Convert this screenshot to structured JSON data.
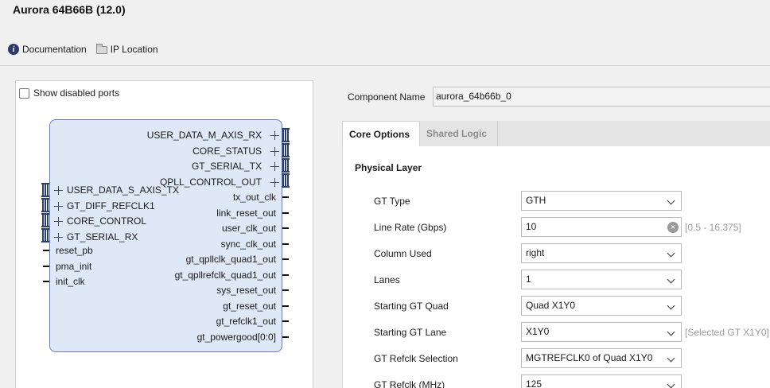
{
  "header": {
    "title": "Aurora 64B66B (12.0)",
    "documentation_label": "Documentation",
    "ip_location_label": "IP Location"
  },
  "symbol_panel": {
    "show_disabled_ports_label": "Show disabled ports",
    "right_bus_ports": [
      "USER_DATA_M_AXIS_RX",
      "CORE_STATUS",
      "GT_SERIAL_TX",
      "QPLL_CONTROL_OUT"
    ],
    "right_signal_ports": [
      "tx_out_clk",
      "link_reset_out",
      "user_clk_out",
      "sync_clk_out",
      "gt_qpllclk_quad1_out",
      "gt_qpllrefclk_quad1_out",
      "sys_reset_out",
      "gt_reset_out",
      "gt_refclk1_out",
      "gt_powergood[0:0]"
    ],
    "left_bus_ports": [
      "USER_DATA_S_AXIS_TX",
      "GT_DIFF_REFCLK1",
      "CORE_CONTROL",
      "GT_SERIAL_RX"
    ],
    "left_signal_ports": [
      "reset_pb",
      "pma_init",
      "init_clk"
    ]
  },
  "config": {
    "component_name_label": "Component Name",
    "component_name_value": "aurora_64b66b_0",
    "tabs": [
      "Core Options",
      "Shared Logic"
    ],
    "section_title": "Physical Layer",
    "rows": [
      {
        "label": "GT Type",
        "value": "GTH",
        "hint": ""
      },
      {
        "label": "Line Rate (Gbps)",
        "value": "10",
        "hint": "[0.5 - 16.375]"
      },
      {
        "label": "Column Used",
        "value": "right",
        "hint": ""
      },
      {
        "label": "Lanes",
        "value": "1",
        "hint": ""
      },
      {
        "label": "Starting GT Quad",
        "value": "Quad X1Y0",
        "hint": ""
      },
      {
        "label": "Starting GT Lane",
        "value": "X1Y0",
        "hint": "[Selected GT X1Y0]"
      },
      {
        "label": "GT Refclk Selection",
        "value": "MGTREFCLK0 of Quad X1Y0",
        "hint": ""
      },
      {
        "label": "GT Refclk (MHz)",
        "value": "125",
        "hint": ""
      }
    ]
  }
}
